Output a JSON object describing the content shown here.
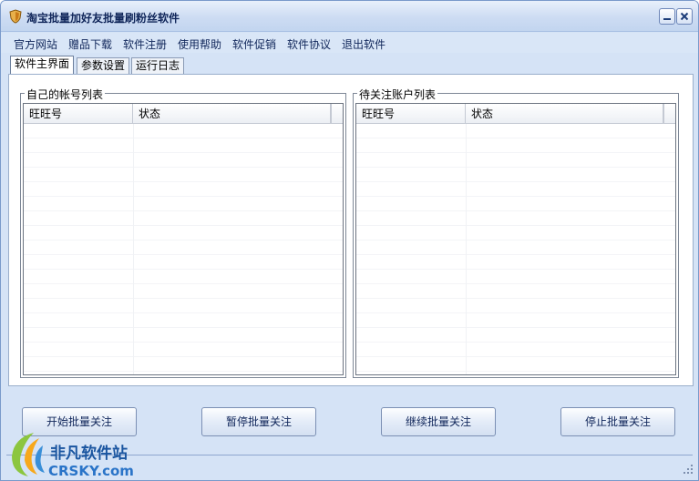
{
  "window": {
    "title": "淘宝批量加好友批量刷粉丝软件"
  },
  "menu": {
    "items": [
      "官方网站",
      "赠品下载",
      "软件注册",
      "使用帮助",
      "软件促销",
      "软件协议",
      "退出软件"
    ]
  },
  "tabs": [
    {
      "label": "软件主界面",
      "active": true
    },
    {
      "label": "参数设置",
      "active": false
    },
    {
      "label": "运行日志",
      "active": false
    }
  ],
  "own_accounts": {
    "group_label": "自己的帐号列表",
    "columns": [
      "旺旺号",
      "状态"
    ],
    "rows": []
  },
  "targets": {
    "group_label": "待关注账户列表",
    "columns": [
      "旺旺号",
      "状态"
    ],
    "rows": []
  },
  "actions": {
    "start": "开始批量关注",
    "pause": "暂停批量关注",
    "resume": "继续批量关注",
    "stop": "停止批量关注"
  },
  "watermark": {
    "name": "非凡软件站",
    "domain": "CRSKY.com"
  },
  "colors": {
    "frame": "#d5e3f6",
    "title_text": "#10265a",
    "accent": "#7a9acb"
  }
}
